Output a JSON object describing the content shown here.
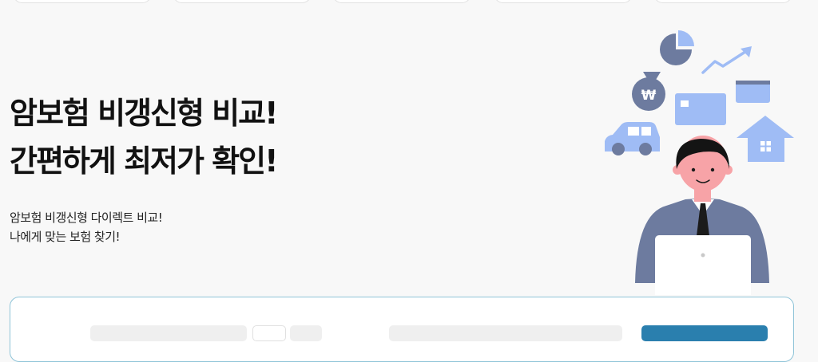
{
  "hero": {
    "title_line1": "암보험 비갱신형 비교!",
    "title_line2": "간편하게 최저가 확인!",
    "subtitle_line1": "암보험 비갱신형 다이렉트 비교!",
    "subtitle_line2": "나에게 맞는 보험 찾기!"
  },
  "illustration": {
    "icons": [
      "pie-chart-icon",
      "trend-up-icon",
      "money-bag-icon",
      "credit-card-icon",
      "wallet-icon",
      "car-icon",
      "house-icon"
    ],
    "money_bag_symbol": "₩"
  },
  "colors": {
    "background": "#f8f8f8",
    "icon_blue": "#9fbcf5",
    "person_shirt": "#6d7b9f",
    "submit_button": "#2a7fae",
    "card_border": "#8fc4d8"
  }
}
